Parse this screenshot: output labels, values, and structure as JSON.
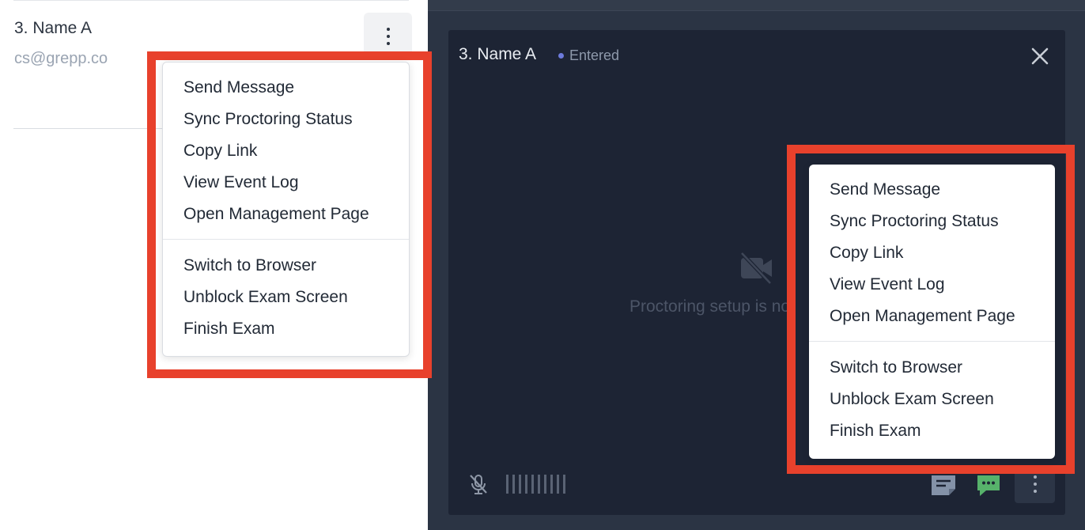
{
  "list_row": {
    "name": "3. Name A",
    "email": "cs@grepp.co"
  },
  "video_card": {
    "title": "3. Name A",
    "status": "Entered",
    "placeholder_text": "Proctoring setup is no",
    "audio_level_bars": 10
  },
  "menu_left": {
    "group1": [
      "Send Message",
      "Sync Proctoring Status",
      "Copy Link",
      "View Event Log",
      "Open Management Page"
    ],
    "group2": [
      "Switch to Browser",
      "Unblock Exam Screen",
      "Finish Exam"
    ]
  },
  "menu_right": {
    "group1": [
      "Send Message",
      "Sync Proctoring Status",
      "Copy Link",
      "View Event Log",
      "Open Management Page"
    ],
    "group2": [
      "Switch to Browser",
      "Unblock Exam Screen",
      "Finish Exam"
    ]
  },
  "icons": {
    "kebab": "more-vertical-icon",
    "close": "close-icon",
    "no_video": "video-off-icon",
    "mic": "mic-off-icon",
    "note": "note-icon",
    "chat": "chat-icon",
    "more": "more-vertical-icon"
  },
  "colors": {
    "highlight": "#e8412c",
    "status_dot": "#6d7bdc",
    "chat_icon": "#57b26b",
    "card_bg": "#1d2434"
  }
}
